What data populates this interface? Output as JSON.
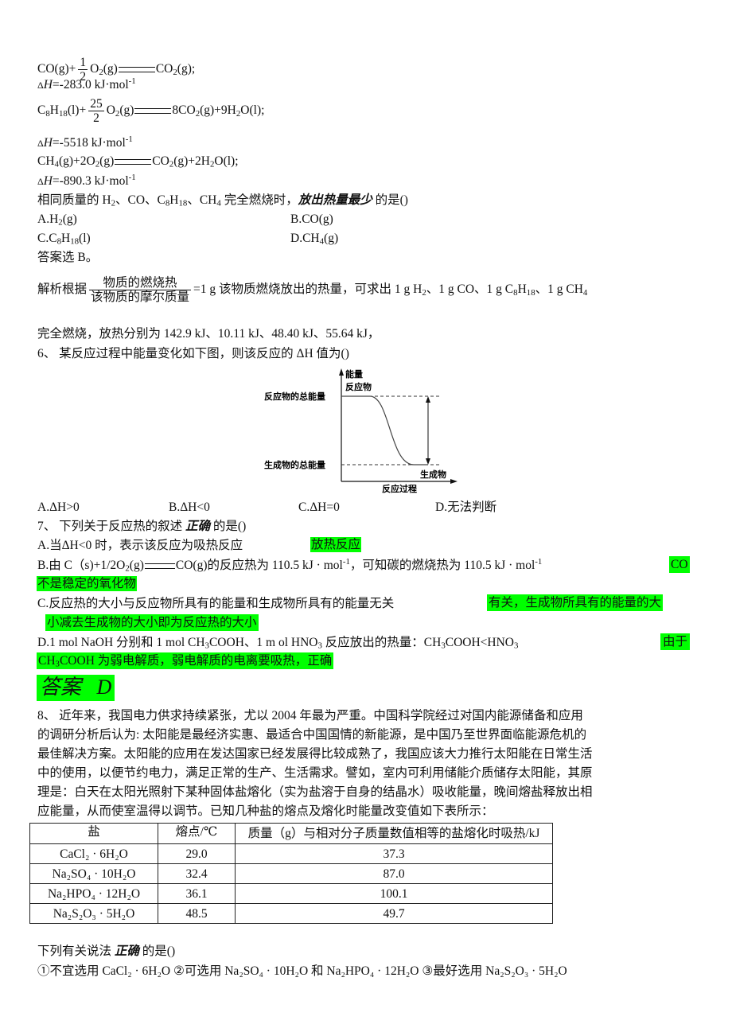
{
  "equations": [
    {
      "lhs_a": "CO(g)+",
      "frac_num": "1",
      "frac_den": "2",
      "lhs_b": "O",
      "lhs_b_sub": "2",
      "lhs_b_tail": "(g)",
      "rhs": "CO",
      "rhs_sub": "2",
      "rhs_tail": "(g);",
      "dh_prefix": "Δ",
      "dh_H": "H",
      "dh_value": "=-283.0 kJ·mol",
      "dh_sup": "-1"
    },
    {
      "c": "C",
      "c_sub": "8",
      "h": "H",
      "h_sub": "18",
      "lhs_tail": "(l)+",
      "frac_num": "25",
      "frac_den": "2",
      "o2": "O",
      "o2_sub": "2",
      "o2_tail": "(g)",
      "rhs_a": "8CO",
      "rhs_a_sub": "2",
      "rhs_b": "(g)+9H",
      "rhs_b_sub": "2",
      "rhs_c": "O(l);",
      "dh_prefix": "Δ",
      "dh_H": "H",
      "dh_value": "=-5518 kJ·mol",
      "dh_sup": "-1"
    },
    {
      "a": "CH",
      "a_sub": "4",
      "b": "(g)+2O",
      "b_sub": "2",
      "c": "(g)",
      "rhs_a": "CO",
      "rhs_a_sub": "2",
      "rhs_b": "(g)+2H",
      "rhs_b_sub": "2",
      "rhs_c": "O(l);",
      "dh_prefix": "Δ",
      "dh_H": "H",
      "dh_value": "=-890.3 kJ·mol",
      "dh_sup": "-1"
    }
  ],
  "q5": {
    "stem_a": "相同质量的 H",
    "s1": "2",
    "stem_b": "、CO、C",
    "s2": "8",
    "stem_c": "H",
    "s3": "18",
    "stem_d": "、CH",
    "s4": "4",
    "stem_e": " 完全燃烧时，",
    "emph": "放出热量最少",
    "stem_f": " 的是()",
    "options": [
      {
        "label": "A.H",
        "sub": "2",
        "tail": "(g)"
      },
      {
        "label": "B.CO(g)"
      },
      {
        "label": "C.C",
        "sub": "8",
        "mid": "H",
        "sub2": "18",
        "tail": "(l)"
      },
      {
        "label": "D.CH",
        "sub": "4",
        "tail": "(g)"
      }
    ],
    "answer": "答案选 B。",
    "analysis_prefix": "解析根据",
    "analysis_frac_num": "物质的燃烧热",
    "analysis_frac_den": "该物质的摩尔质量",
    "analysis_a": "=1 g 该物质燃烧放出的热量，可求出 1 g H",
    "a_s1": "2",
    "analysis_b": "、1 g CO、1 g C",
    "a_s2": "8",
    "analysis_c": "H",
    "a_s3": "18",
    "analysis_d": "、1 g CH",
    "a_s4": "4",
    "analysis_line2": "完全燃烧，放热分别为 142.9 kJ、10.11 kJ、48.40 kJ、55.64 kJ，"
  },
  "q6": {
    "stem": "6、   某反应过程中能量变化如下图，则该反应的 ΔH 值为()",
    "diagram": {
      "y_axis_label": "能量",
      "x_axis_label": "反应过程",
      "reactant_level_label": "反应物的总能量",
      "product_level_label": "生成物的总能量",
      "reactant_label": "反应物",
      "product_label": "生成物"
    },
    "options": [
      "A.ΔH>0",
      "B.ΔH<0",
      "C.ΔH=0",
      "D.无法判断"
    ]
  },
  "q7": {
    "stem_a": "7、   下列关于反应热的叙述 ",
    "emph": "正确",
    "stem_b": " 的是()",
    "A": {
      "text": "A.当ΔH<0 时，表示该反应为吸热反应",
      "note": "放热反应"
    },
    "B": {
      "a": "B.由 C（s)+1/2O",
      "sub": "2",
      "b": "(g)",
      "c": "CO(g)的反应热为 110.5 kJ · mol",
      "sup": "-1",
      "d": "，可知碳的燃烧热为 110.5 kJ · mol",
      "sup2": "-1",
      "note1": "CO",
      "note2": "不是稳定的氧化物"
    },
    "C": {
      "text": "C.反应热的大小与反应物所具有的能量和生成物所具有的能量无关",
      "note1": "有关，生成物所具有的能量的大",
      "note2": "小减去生成物的大小即为反应热的大小"
    },
    "D": {
      "a": "D.1 mol NaOH 分别和 1 mol CH",
      "sub": "3",
      "b": "COOH、1 m ol HNO",
      "sub2": "3",
      "c": " 反应放出的热量：CH",
      "sub3": "3",
      "d": "COOH<HNO",
      "sub4": "3",
      "note1": "由于",
      "note2a": "CH",
      "note2sub": "3",
      "note2b": "COOH 为弱电解质，弱电解质的电离要吸热，正确"
    },
    "answer_a": "答案",
    "answer_b": "D"
  },
  "q8": {
    "paragraph": [
      "8、   近年来，我国电力供求持续紧张，尤以 2004 年最为严重。中国科学院经过对国内能源储备和应用",
      "的调研分析后认为: 太阳能是最经济实惠、最适合中国国情的新能源，是中国乃至世界面临能源危机的",
      "最佳解决方案。太阳能的应用在发达国家已经发展得比较成熟了，我国应该大力推行太阳能在日常生活",
      "中的使用，以便节约电力，满足正常的生产、生活需求。譬如，室内可利用储能介质储存太阳能，其原",
      "理是：白天在太阳光照射下某种固体盐熔化（实为盐溶于自身的结晶水）吸收能量，晚间熔盐释放出相",
      "应能量，从而使室温得以调节。已知几种盐的熔点及熔化时能量改变值如下表所示："
    ],
    "table": {
      "headers": [
        "盐",
        "熔点/℃",
        "质量（g）与相对分子质量数值相等的盐熔化时吸热/kJ"
      ],
      "rows": [
        {
          "salt": "CaCl₂ · 6H₂O",
          "mp": "29.0",
          "heat": "37.3"
        },
        {
          "salt": "Na₂SO₄ · 10H₂O",
          "mp": "32.4",
          "heat": "87.0"
        },
        {
          "salt": "Na₂HPO₄ · 12H₂O",
          "mp": "36.1",
          "heat": "100.1"
        },
        {
          "salt": "Na₂S₂O₃ · 5H₂O",
          "mp": "48.5",
          "heat": "49.7"
        }
      ]
    },
    "stem_a": "下列有关说法 ",
    "emph": "正确",
    "stem_b": " 的是()",
    "statements": "①不宜选用 CaCl₂ · 6H₂O   ②可选用 Na₂SO₄ · 10H₂O 和 Na₂HPO₄ · 12H₂O   ③最好选用 Na₂S₂O₃ · 5H₂O"
  },
  "colors": {
    "highlight": "#00ff00",
    "text": "#111111"
  }
}
